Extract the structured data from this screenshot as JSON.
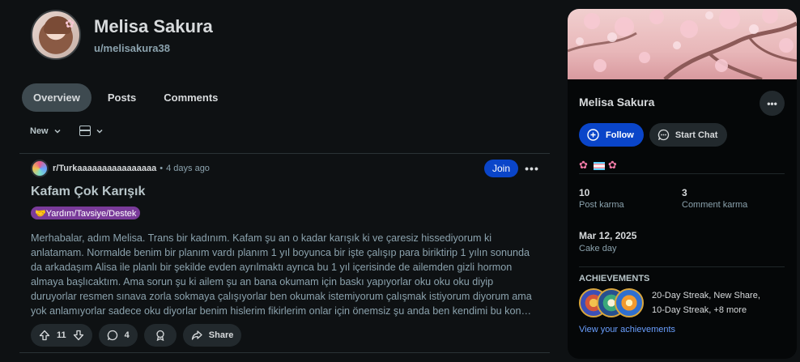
{
  "profile": {
    "display_name": "Melisa Sakura",
    "username": "u/melisakura38"
  },
  "tabs": [
    {
      "label": "Overview"
    },
    {
      "label": "Posts"
    },
    {
      "label": "Comments"
    }
  ],
  "sort": {
    "label": "New"
  },
  "post": {
    "subreddit": "r/Turkaaaaaaaaaaaaaaaa",
    "time": "4 days ago",
    "join_label": "Join",
    "title": "Kafam Çok Karışık",
    "flair": "🤝Yardım/Tavsiye/Destek",
    "body_lines": [
      "Merhabalar, adım Melisa. Trans bir kadınım. Kafam şu an o kadar karışık ki ve çaresiz hissediyorum ki",
      "anlatamam. Normalde benim bir planım vardı planım 1 yıl boyunca bir işte çalışıp para biriktirip 1 yılın sonunda",
      "da arkadaşım Alisa ile planlı bir şekilde evden ayrılmaktı ayrıca bu 1 yıl içerisinde de ailemden gizli hormon",
      "almaya başlıcaktım. Ama sorun şu ki ailem şu an bana okumam için baskı yapıyorlar oku oku oku diyip",
      "duruyorlar resmen sınava zorla sokmaya çalışıyorlar ben okumak istemiyorum çalışmak istiyorum diyorum ama",
      "yok anlamıyorlar sadece oku diyorlar benim hislerim fikirlerim onlar için önemsiz şu anda ben kendimi bu konu…"
    ],
    "votes": "11",
    "comments": "4",
    "share_label": "Share"
  },
  "sidebar": {
    "name": "Melisa Sakura",
    "follow_label": "Follow",
    "chat_label": "Start Chat",
    "post_karma": "10",
    "post_karma_label": "Post karma",
    "comment_karma": "3",
    "comment_karma_label": "Comment karma",
    "cake_day": "Mar 12, 2025",
    "cake_day_label": "Cake day",
    "achievements_title": "ACHIEVEMENTS",
    "achievements_line1": "20-Day Streak, New Share,",
    "achievements_line2": "10-Day Streak, +8 more",
    "achievements_link": "View your achievements",
    "flag_icons": [
      "pink-flower-icon",
      "trans-flag-icon",
      "pink-flower-icon"
    ]
  },
  "colors": {
    "accent": "#0a45c9",
    "background": "#0e1113",
    "link": "#6a9fff",
    "flair": "#7a3b9a"
  }
}
